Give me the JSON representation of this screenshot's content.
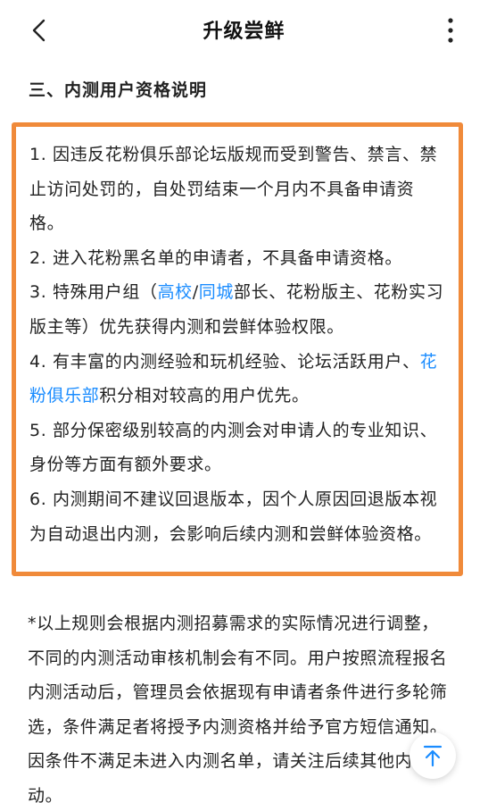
{
  "header": {
    "title": "升级尝鲜"
  },
  "section": {
    "heading": "三、内测用户资格说明"
  },
  "rules": {
    "r1": "1. 因违反花粉俱乐部论坛版规而受到警告、禁言、禁止访问处罚的，自处罚结束一个月内不具备申请资格。",
    "r2": "2. 进入花粉黑名单的申请者，不具备申请资格。",
    "r3": {
      "prefix": "3. 特殊用户组（",
      "link1": "高校",
      "sep": "/",
      "link2": "同城",
      "suffix": "部长、花粉版主、花粉实习版主等）优先获得内测和尝鲜体验权限。"
    },
    "r4": {
      "prefix": "4. 有丰富的内测经验和玩机经验、论坛活跃用户、",
      "link": "花粉俱乐部",
      "suffix": "积分相对较高的用户优先。"
    },
    "r5": "5. 部分保密级别较高的内测会对申请人的专业知识、身份等方面有额外要求。",
    "r6": "6. 内测期间不建议回退版本，因个人原因回退版本视为自动退出内测，会影响后续内测和尝鲜体验资格。"
  },
  "note": "*以上规则会根据内测招募需求的实际情况进行调整，不同的内测活动审核机制会有不同。用户按照流程报名内测活动后，管理员会依据现有申请者条件进行多轮筛选，条件满足者将授予内测资格并给予官方短信通知。因条件不满足未进入内测名单，请关注后续其他内测活动。",
  "icons": {
    "back": "chevron-left-icon",
    "more": "more-vertical-icon",
    "scroll_top": "arrow-up-to-top-icon"
  },
  "colors": {
    "highlight_border": "#f08a3a",
    "link": "#1a8cff",
    "text": "#222222"
  }
}
